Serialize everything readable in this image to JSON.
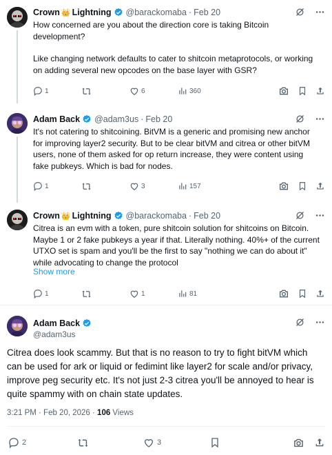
{
  "tweets": [
    {
      "name": "Crown",
      "name_suffix": "Lightning",
      "emoji": "👑",
      "handle": "@barackomaba",
      "time": "Feb 20",
      "text": [
        "How concerned are you about the direction core is taking Bitcoin development?",
        "Like changing network defaults to cater to shitcoin metaprotocols, or working on adding several new opcodes on the base layer with GSR?"
      ],
      "counts": {
        "replies": "1",
        "reposts": "",
        "likes": "6",
        "views": "360"
      }
    },
    {
      "name": "Adam Back",
      "handle": "@adam3us",
      "time": "Feb 20",
      "text": [
        "It's not catering to shitcoining. BitVM is a generic and promising new anchor for improving layer2 security. But to be clear bitVM and citrea or other bitVM users, none of them asked for op return increase, they were content using fake pubkeys. Which is bad for nodes."
      ],
      "counts": {
        "replies": "1",
        "reposts": "",
        "likes": "3",
        "views": "157"
      }
    },
    {
      "name": "Crown",
      "name_suffix": "Lightning",
      "emoji": "👑",
      "handle": "@barackomaba",
      "time": "Feb 20",
      "text": [
        "Citrea is an evm with a token, pure shitcoin solution for shitcoins on Bitcoin. Maybe 1 or 2 fake pubkeys a year if that. Literally nothing. 40%+ of the current UTXO set is spam and you'll be the first to say \"nothing we can do about it\" while advocating to change the protocol"
      ],
      "show_more": "Show more",
      "counts": {
        "replies": "1",
        "reposts": "",
        "likes": "1",
        "views": "81"
      }
    }
  ],
  "main_tweet": {
    "name": "Adam Back",
    "handle": "@adam3us",
    "text": "Citrea does look scammy. But that is no reason to try to fight bitVM which can be used for ark or liquid or fedimint like layer2 for scale and/or privacy, improve peg security etc. It's not just 2-3 citrea you'll be annoyed to hear is quite spammy with on chain state updates.",
    "timestamp": "3:21 PM · Feb 20, 2026 · ",
    "views_count": "106",
    "views_label": " Views",
    "counts": {
      "replies": "2",
      "reposts": "",
      "likes": "3"
    }
  },
  "colors": {
    "text": "#0f1419",
    "secondary": "#536471",
    "accent": "#1d9bf0",
    "verified": "#1d9bf0",
    "divider": "#eff3f4"
  },
  "icons": [
    "reply-icon",
    "repost-icon",
    "like-icon",
    "views-icon",
    "grok-icon",
    "more-icon",
    "screenshot-icon",
    "bookmark-icon",
    "share-icon",
    "verified-badge-icon"
  ]
}
